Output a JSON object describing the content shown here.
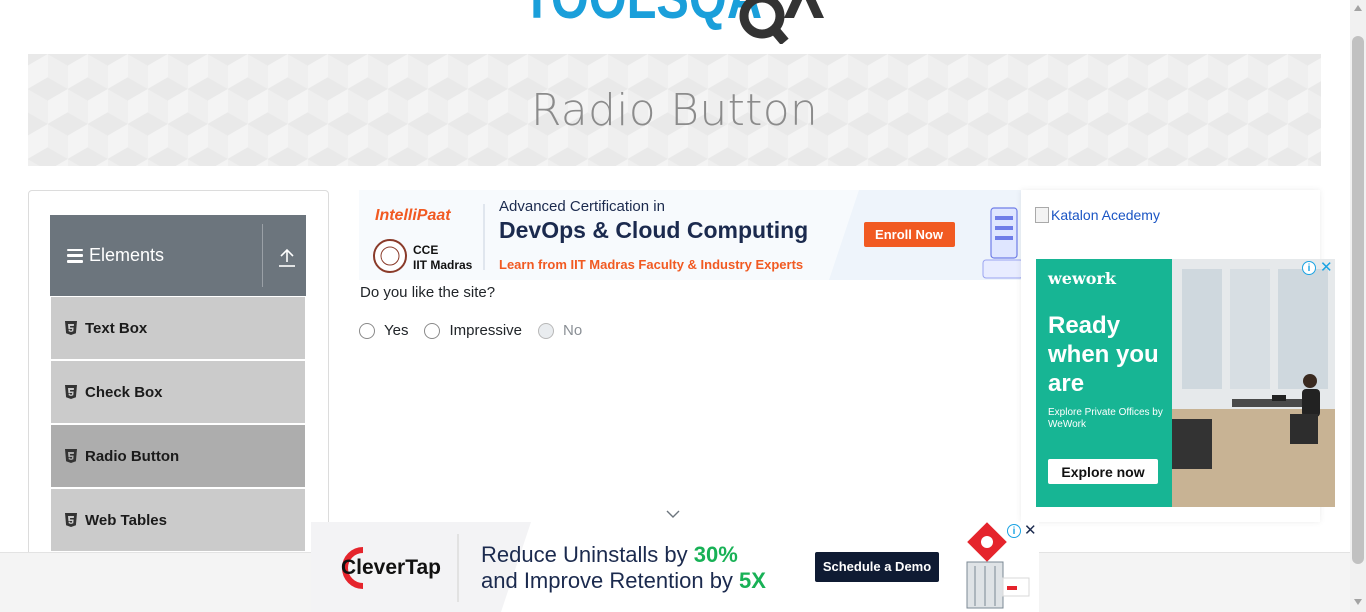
{
  "page": {
    "title": "Radio Button"
  },
  "logo": {
    "text": "TOOLSQA"
  },
  "sidebar": {
    "group_title": "Elements",
    "items": [
      {
        "label": "Text Box",
        "active": false
      },
      {
        "label": "Check Box",
        "active": false
      },
      {
        "label": "Radio Button",
        "active": true
      },
      {
        "label": "Web Tables",
        "active": false
      }
    ]
  },
  "ad_top": {
    "brand": "IntelliPaat",
    "partner_line1": "CCE",
    "partner_line2": "IIT Madras",
    "line1": "Advanced Certification in",
    "line2": "DevOps & Cloud Computing",
    "line3": "Learn from IIT Madras Faculty & Industry Experts",
    "cta": "Enroll Now"
  },
  "form": {
    "question": "Do you like the site?",
    "options": [
      {
        "label": "Yes",
        "disabled": false
      },
      {
        "label": "Impressive",
        "disabled": false
      },
      {
        "label": "No",
        "disabled": true
      }
    ]
  },
  "right_ads": {
    "katalon_alt": "Katalon Acedemy",
    "wework": {
      "brand": "wework",
      "headline": "Ready when you are",
      "sub": "Explore Private Offices by WeWork",
      "cta": "Explore now"
    }
  },
  "ad_bottom": {
    "brand": "CleverTap",
    "line1_prefix": "Reduce Uninstalls by ",
    "line1_value": "30%",
    "line2_prefix": "and Improve Retention by ",
    "line2_value": "5X",
    "cta": "Schedule a Demo"
  },
  "colors": {
    "accent_blue": "#1aa3e3",
    "sidebar_header": "#6c757d",
    "menu_item": "#cbcbcb",
    "menu_item_active": "#adadad",
    "intellipaat_orange": "#f15a22",
    "clevertap_green": "#18b156",
    "wework_green": "#17b594"
  },
  "icons": {
    "hamburger": "hamburger-icon",
    "collapse": "collapse-up-icon",
    "menu_item": "html5-icon",
    "chevron": "chevron-down-icon",
    "adchoices": "adchoices-icon",
    "close": "close-icon"
  }
}
